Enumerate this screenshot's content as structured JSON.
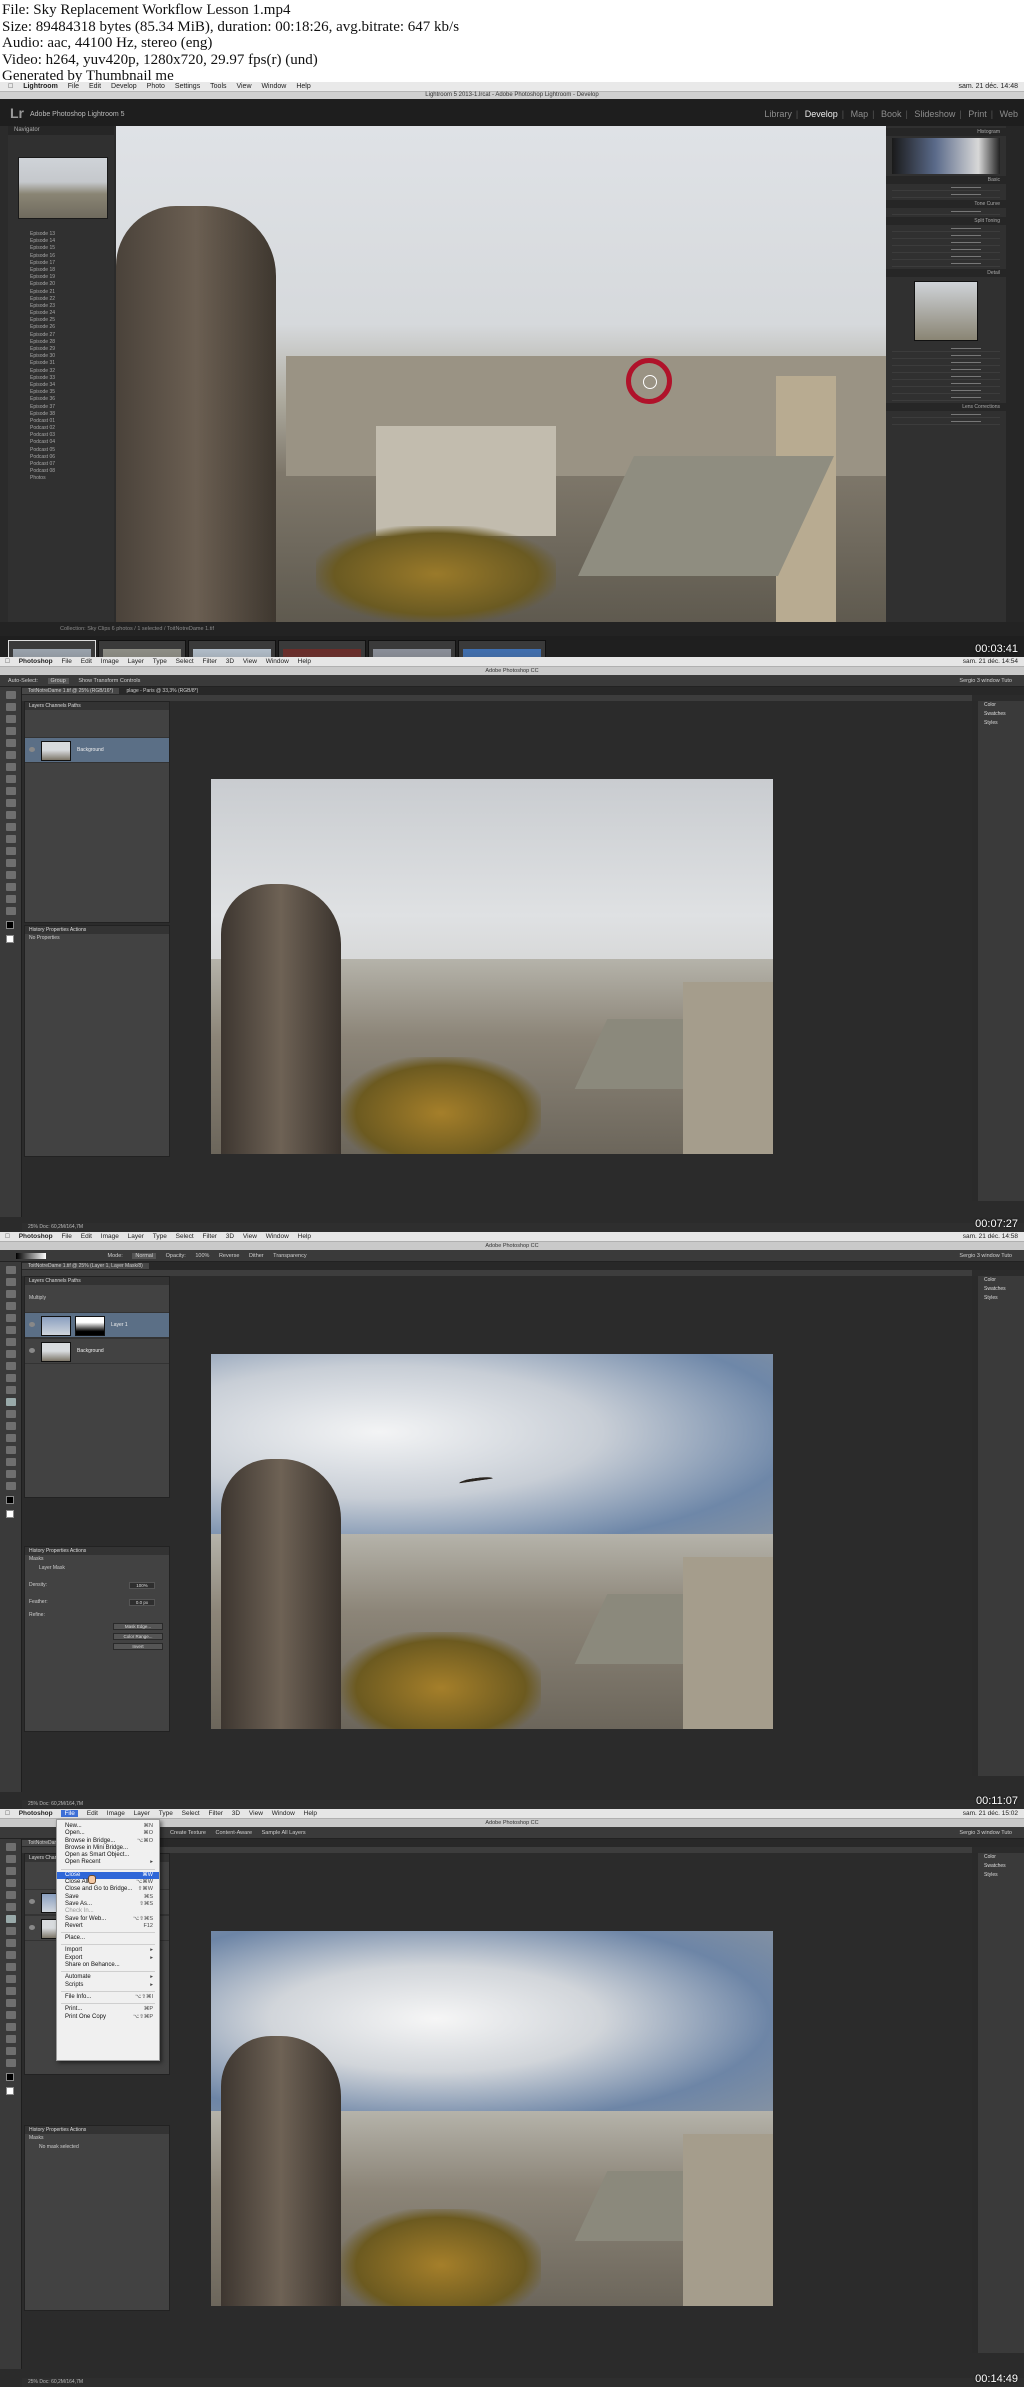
{
  "info": {
    "lines": [
      "File: Sky Replacement Workflow Lesson 1.mp4",
      "Size: 89484318 bytes (85.34 MiB), duration: 00:18:26, avg.bitrate: 647 kb/s",
      "Audio: aac, 44100 Hz, stereo (eng)",
      "Video: h264, yuv420p, 1280x720, 29.97 fps(r) (und)",
      "Generated by Thumbnail me"
    ]
  },
  "frames": [
    {
      "timestamp": "00:03:41"
    },
    {
      "timestamp": "00:07:27"
    },
    {
      "timestamp": "00:11:07"
    },
    {
      "timestamp": "00:14:49"
    }
  ],
  "lightroom": {
    "menubar": [
      "Lightroom",
      "File",
      "Edit",
      "Develop",
      "Photo",
      "Settings",
      "Tools",
      "View",
      "Window",
      "Help"
    ],
    "menubar_right": "sam. 21 déc. 14:48",
    "title": "Lightroom 5 2013-1.lrcat - Adobe Photoshop Lightroom - Develop",
    "logo": "Lr",
    "brand": "Adobe Photoshop Lightroom 5",
    "modules": [
      "Library",
      "Develop",
      "Map",
      "Book",
      "Slideshow",
      "Print",
      "Web"
    ],
    "active_module": "Develop",
    "navigator_label": "Navigator",
    "folders": [
      "Episode 13",
      "Episode 14",
      "Episode 15",
      "Episode 16",
      "Episode 17",
      "Episode 18",
      "Episode 19",
      "Episode 20",
      "Episode 21",
      "Episode 22",
      "Episode 23",
      "Episode 24",
      "Episode 25",
      "Episode 26",
      "Episode 27",
      "Episode 28",
      "Episode 29",
      "Episode 30",
      "Episode 31",
      "Episode 32",
      "Episode 33",
      "Episode 34",
      "Episode 35",
      "Episode 36",
      "Episode 37",
      "Episode 38",
      "Podcast 01",
      "Podcast 02",
      "Podcast 03",
      "Podcast 04",
      "Podcast 05",
      "Podcast 06",
      "Podcast 07",
      "Podcast 08",
      "Photos"
    ],
    "right_sections": [
      "Histogram",
      "Basic",
      "Tone Curve",
      "Split Toning",
      "Detail",
      "Lens Corrections"
    ],
    "filmstrip_label": "Collection: Sky Clips   6 photos / 1 selected / ToitNotreDame 1.tif",
    "film_colors": [
      "#9aa3ad",
      "#8e8e86",
      "#b1bdc9",
      "#6b2d2a",
      "#8a8f99",
      "#3f6fb0"
    ]
  },
  "photoshop": {
    "menubar": [
      "Photoshop",
      "File",
      "Edit",
      "Image",
      "Layer",
      "Type",
      "Select",
      "Filter",
      "3D",
      "View",
      "Window",
      "Help"
    ],
    "title": "Adobe Photoshop CC",
    "workspace": "Sergio 3 window Tuto",
    "frame2": {
      "menubar_right": "sam. 21 déc. 14:54",
      "options": [
        "Auto-Select:",
        "Group",
        "Show Transform Controls"
      ],
      "tab": "ToitNotreDame 1.tif @ 25% (RGB/16*)",
      "tab2": "plage - Paris @ 33,3% (RGB/8*)",
      "layer_name": "Background",
      "props_title": "No Properties",
      "status": "25%   Doc: 60,2M/164,7M"
    },
    "frame3": {
      "menubar_right": "sam. 21 déc. 14:58",
      "options": [
        "Mode:",
        "Normal",
        "Opacity:",
        "100%",
        "Reverse",
        "Dither",
        "Transparency"
      ],
      "tab": "ToitNotreDame 1.tif @ 25% (Layer 1, Layer Mask/8)",
      "layers": [
        "Layer 1",
        "Background"
      ],
      "blend": "Multiply",
      "props_title": "Masks",
      "props_sub": "Layer Mask",
      "density_label": "Density:",
      "density": "100%",
      "feather_label": "Feather:",
      "feather": "0.0 px",
      "refine_label": "Refine:",
      "buttons": [
        "Mask Edge...",
        "Color Range...",
        "Invert"
      ],
      "status": "25%   Doc: 60,2M/164,7M"
    },
    "frame4": {
      "menubar_right": "sam. 21 déc. 15:02",
      "options": [
        "Create Texture",
        "Content-Aware",
        "Sample All Layers"
      ],
      "open_menu": "File",
      "menu": [
        {
          "label": "New...",
          "sc": "⌘N"
        },
        {
          "label": "Open...",
          "sc": "⌘O"
        },
        {
          "label": "Browse in Bridge...",
          "sc": "⌥⌘O"
        },
        {
          "label": "Browse in Mini Bridge...",
          "sc": ""
        },
        {
          "label": "Open as Smart Object...",
          "sc": ""
        },
        {
          "label": "Open Recent",
          "sc": "▸"
        },
        {
          "sep": true
        },
        {
          "label": "Close",
          "sc": "⌘W",
          "hl": true
        },
        {
          "label": "Close All",
          "sc": "⌥⌘W"
        },
        {
          "label": "Close and Go to Bridge...",
          "sc": "⇧⌘W"
        },
        {
          "label": "Save",
          "sc": "⌘S"
        },
        {
          "label": "Save As...",
          "sc": "⇧⌘S"
        },
        {
          "label": "Check In...",
          "sc": "",
          "dis": true
        },
        {
          "label": "Save for Web...",
          "sc": "⌥⇧⌘S"
        },
        {
          "label": "Revert",
          "sc": "F12"
        },
        {
          "sep": true
        },
        {
          "label": "Place...",
          "sc": ""
        },
        {
          "sep": true
        },
        {
          "label": "Import",
          "sc": "▸"
        },
        {
          "label": "Export",
          "sc": "▸"
        },
        {
          "label": "Share on Behance...",
          "sc": ""
        },
        {
          "sep": true
        },
        {
          "label": "Automate",
          "sc": "▸"
        },
        {
          "label": "Scripts",
          "sc": "▸"
        },
        {
          "sep": true
        },
        {
          "label": "File Info...",
          "sc": "⌥⇧⌘I"
        },
        {
          "sep": true
        },
        {
          "label": "Print...",
          "sc": "⌘P"
        },
        {
          "label": "Print One Copy",
          "sc": "⌥⇧⌘P"
        }
      ],
      "props_title": "Masks",
      "props_sub": "No mask selected",
      "status": "25%   Doc: 60,2M/164,7M"
    },
    "panels": [
      "Color",
      "Swatches",
      "Styles"
    ]
  }
}
